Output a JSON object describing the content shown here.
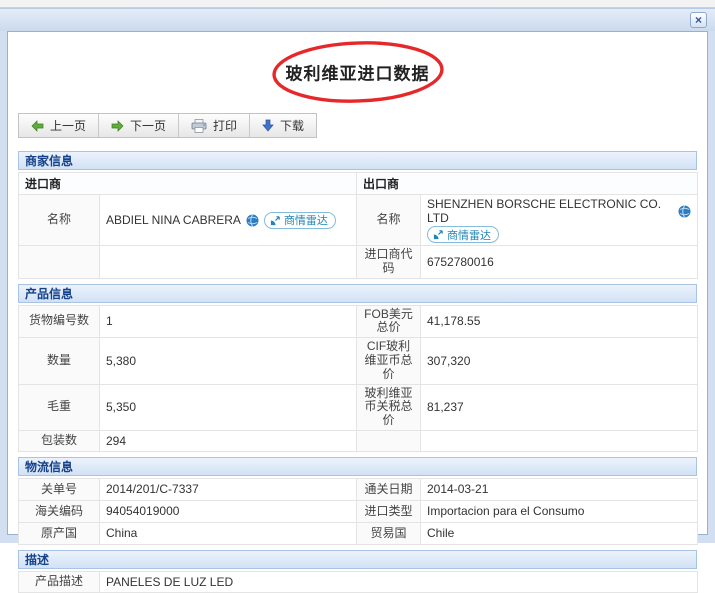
{
  "window": {
    "close_label": "×"
  },
  "title": "玻利维亚进口数据",
  "toolbar": {
    "buttons": [
      {
        "label": "上一页",
        "icon": "arrow-left-green-icon"
      },
      {
        "label": "下一页",
        "icon": "arrow-right-green-icon"
      },
      {
        "label": "打印",
        "icon": "printer-icon"
      },
      {
        "label": "下载",
        "icon": "arrow-down-blue-icon"
      }
    ]
  },
  "merchant": {
    "header": "商家信息",
    "importer_header": "进口商",
    "exporter_header": "出口商",
    "name_label": "名称",
    "importer_name": "ABDIEL NINA CABRERA",
    "exporter_name": "SHENZHEN BORSCHE ELECTRONIC CO. LTD",
    "radar_badge_label": "商情雷达",
    "importer_code_label": "进口商代码",
    "importer_code": "6752780016"
  },
  "product": {
    "header": "产品信息",
    "rows": [
      {
        "left_label": "货物编号数",
        "left_value": "1",
        "right_label": "FOB美元总价",
        "right_value": "41,178.55"
      },
      {
        "left_label": "数量",
        "left_value": "5,380",
        "right_label": "CIF玻利维亚币总价",
        "right_value": "307,320"
      },
      {
        "left_label": "毛重",
        "left_value": "5,350",
        "right_label": "玻利维亚币关税总价",
        "right_value": "81,237"
      },
      {
        "left_label": "包装数",
        "left_value": "294",
        "right_label": "",
        "right_value": ""
      }
    ]
  },
  "logistics": {
    "header": "物流信息",
    "rows": [
      {
        "left_label": "关单号",
        "left_value": "2014/201/C-7337",
        "right_label": "通关日期",
        "right_value": "2014-03-21"
      },
      {
        "left_label": "海关编码",
        "left_value": "94054019000",
        "right_label": "进口类型",
        "right_value": "Importacion para el Consumo"
      },
      {
        "left_label": "原产国",
        "left_value": "China",
        "right_label": "贸易国",
        "right_value": "Chile"
      }
    ]
  },
  "description": {
    "header": "描述",
    "label": "产品描述",
    "value": "PANELES DE LUZ LED"
  },
  "colors": {
    "accent_navy": "#15428b",
    "annotation_red": "#e6282b",
    "badge_blue": "#2185b4",
    "arrow_green": "#5fae3a",
    "arrow_blue": "#3f74c9"
  }
}
